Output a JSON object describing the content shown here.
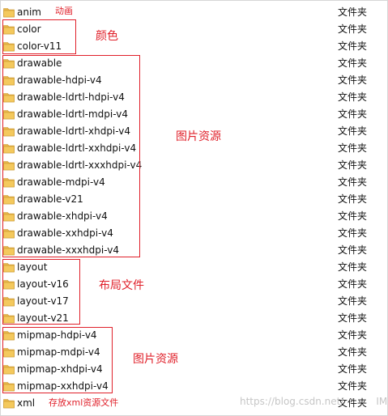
{
  "type_label": "文件夹",
  "folders": [
    {
      "name": "anim"
    },
    {
      "name": "color"
    },
    {
      "name": "color-v11"
    },
    {
      "name": "drawable"
    },
    {
      "name": "drawable-hdpi-v4"
    },
    {
      "name": "drawable-ldrtl-hdpi-v4"
    },
    {
      "name": "drawable-ldrtl-mdpi-v4"
    },
    {
      "name": "drawable-ldrtl-xhdpi-v4"
    },
    {
      "name": "drawable-ldrtl-xxhdpi-v4"
    },
    {
      "name": "drawable-ldrtl-xxxhdpi-v4"
    },
    {
      "name": "drawable-mdpi-v4"
    },
    {
      "name": "drawable-v21"
    },
    {
      "name": "drawable-xhdpi-v4"
    },
    {
      "name": "drawable-xxhdpi-v4"
    },
    {
      "name": "drawable-xxxhdpi-v4"
    },
    {
      "name": "layout"
    },
    {
      "name": "layout-v16"
    },
    {
      "name": "layout-v17"
    },
    {
      "name": "layout-v21"
    },
    {
      "name": "mipmap-hdpi-v4"
    },
    {
      "name": "mipmap-mdpi-v4"
    },
    {
      "name": "mipmap-xhdpi-v4"
    },
    {
      "name": "mipmap-xxhdpi-v4"
    },
    {
      "name": "xml"
    }
  ],
  "annotations": {
    "anim": "动画",
    "color": "颜色",
    "drawable": "图片资源",
    "layout": "布局文件",
    "mipmap": "图片资源",
    "xml": "存放xml资源文件"
  },
  "watermark": "https://blog.csdn.net/",
  "watermark_tail": "IM",
  "colors": {
    "annotation": "#e0202a",
    "folder": "#f4c95d",
    "text": "#111111"
  },
  "icon": "folder-icon"
}
